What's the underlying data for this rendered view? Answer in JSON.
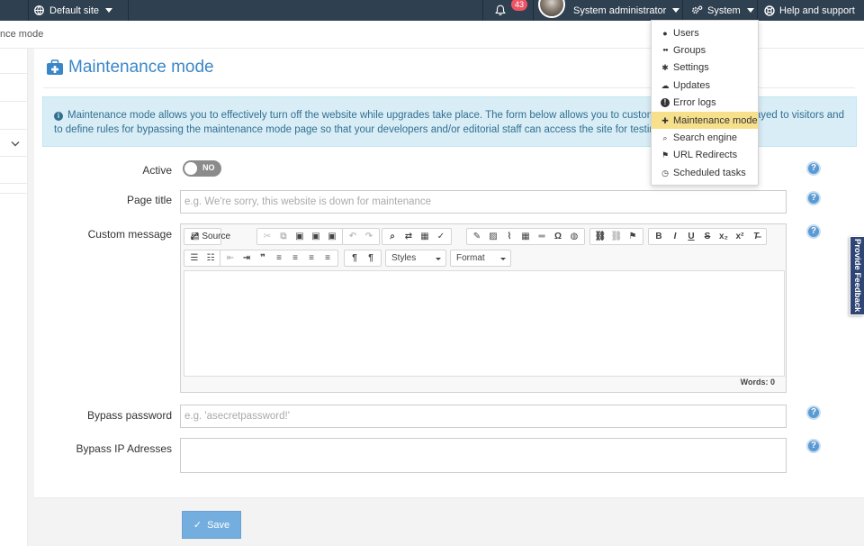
{
  "topbar": {
    "site_label": "Default site",
    "notification_count": "43",
    "user_name": "System administrator",
    "system_label": "System",
    "help_label": "Help and support"
  },
  "breadcrumb": {
    "current": "nce mode"
  },
  "page": {
    "title": "Maintenance mode",
    "info_text": "Maintenance mode allows you to effectively turn off the website while upgrades take place. The form below allows you to customise the message displayed to visitors and to define rules for bypassing the maintenance mode page so that your developers and/or editorial staff can access the site for testing."
  },
  "form": {
    "active_label": "Active",
    "active_state": "NO",
    "page_title_label": "Page title",
    "page_title_placeholder": "e.g. We're sorry, this website is down for maintenance",
    "custom_message_label": "Custom message",
    "bypass_password_label": "Bypass password",
    "bypass_password_placeholder": "e.g. 'asecretpassword!'",
    "bypass_ip_label": "Bypass IP Adresses",
    "help_glyph": "?",
    "save_label": "Save"
  },
  "editor": {
    "source_label": "Source",
    "styles_label": "Styles",
    "format_label": "Format",
    "word_count": "Words: 0"
  },
  "menu": {
    "items": [
      {
        "label": "Users",
        "icon": "user-icon"
      },
      {
        "label": "Groups",
        "icon": "users-icon"
      },
      {
        "label": "Settings",
        "icon": "cogs-icon"
      },
      {
        "label": "Updates",
        "icon": "cloud-download-icon"
      },
      {
        "label": "Error logs",
        "icon": "exclamation-circle-icon"
      },
      {
        "label": "Maintenance mode",
        "icon": "medkit-icon"
      },
      {
        "label": "Search engine",
        "icon": "search-icon"
      },
      {
        "label": "URL Redirects",
        "icon": "flag-icon"
      },
      {
        "label": "Scheduled tasks",
        "icon": "clock-icon"
      }
    ],
    "active_index": 5
  },
  "feedback": {
    "label": "Provide Feedback"
  },
  "colors": {
    "topbar": "#2f4050",
    "accent": "#3a87c8",
    "menu_active": "#f7e08c",
    "save_button": "#74aede",
    "badge": "#ed5565"
  }
}
